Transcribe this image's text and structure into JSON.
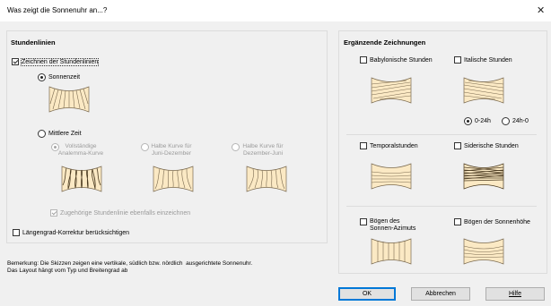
{
  "window": {
    "title": "Was zeigt die Sonnenuhr an...?"
  },
  "left": {
    "group_title": "Stundenlinien",
    "draw_lines": {
      "label": "Zeichnen der Stundenlinien",
      "checked": true
    },
    "sun_time": {
      "label": "Sonnenzeit",
      "selected": true
    },
    "mean_time": {
      "label": "Mittlere Zeit",
      "selected": false
    },
    "sub_options": [
      {
        "label": "Vollständige\nAnalemma-Kurve",
        "selected": true
      },
      {
        "label": "Halbe Kurve für\nJuni-Dezember",
        "selected": false
      },
      {
        "label": "Halbe Kurve für\nDezember-Juni",
        "selected": false
      }
    ],
    "also_draw": {
      "label": "Zugehörige Stundenlinie ebenfalls einzeichnen",
      "checked": true
    },
    "longitude": {
      "label": "Längengrad-Korrektur berücksichtigen",
      "checked": false
    }
  },
  "right": {
    "group_title": "Ergänzende Zeichnungen",
    "babylonian": {
      "label": "Babylonische Stunden",
      "checked": false
    },
    "italic": {
      "label": "Italische Stunden",
      "checked": false
    },
    "range_0_24": {
      "label": "0-24h",
      "selected": true
    },
    "range_24_0": {
      "label": "24h-0",
      "selected": false
    },
    "temporal": {
      "label": "Temporalstunden",
      "checked": false
    },
    "sidereal": {
      "label": "Siderische Stunden",
      "checked": false
    },
    "azimuth_arcs": {
      "label": "Bögen des\nSonnen-Azimuts",
      "checked": false
    },
    "altitude_arcs": {
      "label": "Bögen der Sonnenhöhe",
      "checked": false
    }
  },
  "note": "Bemerkung: Die Skizzen zeigen eine vertikale, südlich bzw. nördlich  ausgerichtete Sonnenuhr.\nDas Layout hängt vom Typ und Breitengrad ab",
  "buttons": {
    "ok": "OK",
    "cancel": "Abbrechen",
    "help": "Hilfe"
  },
  "colors": {
    "sketch_fill": "#fbe9c4",
    "sketch_line": "#7a6a50",
    "default_button_border": "#0078d7"
  }
}
